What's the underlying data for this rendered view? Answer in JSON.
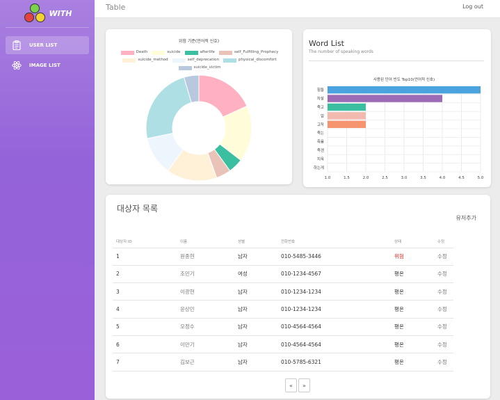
{
  "app": {
    "logo_text": "WITH",
    "page_title": "Table",
    "logout_label": "Log out"
  },
  "sidebar": {
    "items": [
      {
        "label": "USER LIST",
        "icon": "clipboard-icon",
        "active": true
      },
      {
        "label": "IMAGE LIST",
        "icon": "atom-icon",
        "active": false
      }
    ]
  },
  "donut": {
    "chart_data": {
      "type": "pie",
      "title": "위험 기준(언어적 신호)",
      "legend_position": "top",
      "series": [
        {
          "name": "Death",
          "value": 20,
          "color": "#ffb1c1"
        },
        {
          "name": "suicide",
          "value": 19,
          "color": "#fffcd9"
        },
        {
          "name": "afterlife",
          "value": 5,
          "color": "#3cbfa0"
        },
        {
          "name": "self_Fulfilling_Prophecy",
          "value": 5,
          "color": "#e9c2b8"
        },
        {
          "name": "suicide_method",
          "value": 17,
          "color": "#fff0d8"
        },
        {
          "name": "self_deprecation",
          "value": 13,
          "color": "#eef6fd"
        },
        {
          "name": "physical_discomfort",
          "value": 26,
          "color": "#addfe5"
        },
        {
          "name": "suicide_victim",
          "value": 5,
          "color": "#b8c8de"
        }
      ]
    }
  },
  "word_list": {
    "title": "Word List",
    "subtitle": "The number of speaking words",
    "chart_data": {
      "type": "bar",
      "orientation": "horizontal",
      "title": "사용된 단어 빈도 Top10(언어적 신호)",
      "categories": [
        "힘들",
        "자살",
        "죽고",
        "암",
        "고작",
        "죽는",
        "죽을",
        "죽겐",
        "지옥",
        "하는게"
      ],
      "values": [
        5,
        4,
        2,
        2,
        2,
        0,
        0,
        0,
        0,
        0
      ],
      "colors": [
        "#4aa3df",
        "#9b6bb5",
        "#3cbfa0",
        "#f2b9ae",
        "#f5946e",
        "#cccccc",
        "#cccccc",
        "#cccccc",
        "#cccccc",
        "#cccccc"
      ],
      "xlim": [
        1.0,
        5.0
      ],
      "xticks": [
        "1.0",
        "1.5",
        "2.0",
        "2.5",
        "3.0",
        "3.5",
        "4.0",
        "4.5",
        "5.0"
      ],
      "grid": true
    }
  },
  "users": {
    "title": "대상자 목록",
    "add_label": "유저추가",
    "columns": [
      "대상자 ID",
      "이름",
      "성별",
      "전화번호",
      "상태",
      "수정"
    ],
    "rows": [
      {
        "id": "1",
        "name": "원종현",
        "gender": "남자",
        "phone": "010-5485-3446",
        "status": "위험",
        "edit": "수정"
      },
      {
        "id": "2",
        "name": "조민기",
        "gender": "여성",
        "phone": "010-1234-4567",
        "status": "평온",
        "edit": "수정"
      },
      {
        "id": "3",
        "name": "이광현",
        "gender": "남자",
        "phone": "010-1234-1234",
        "status": "평온",
        "edit": "수정"
      },
      {
        "id": "4",
        "name": "윤상민",
        "gender": "남자",
        "phone": "010-1234-1234",
        "status": "평온",
        "edit": "수정"
      },
      {
        "id": "5",
        "name": "오정수",
        "gender": "남자",
        "phone": "010-4564-4564",
        "status": "평온",
        "edit": "수정"
      },
      {
        "id": "6",
        "name": "이만기",
        "gender": "남자",
        "phone": "010-4564-4564",
        "status": "평온",
        "edit": "수정"
      },
      {
        "id": "7",
        "name": "김보근",
        "gender": "남자",
        "phone": "010-5785-6321",
        "status": "평온",
        "edit": "수정"
      }
    ],
    "pager": {
      "prev": "«",
      "next": "»"
    }
  },
  "colors": {
    "sidebar": "#9463d9",
    "danger": "#e8271f"
  }
}
